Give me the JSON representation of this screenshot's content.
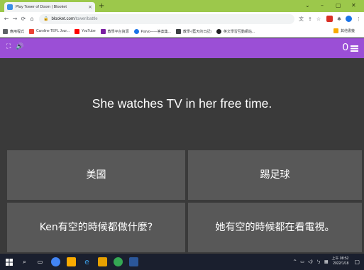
{
  "browser": {
    "tab_title": "Play Tower of Doom | Blooket",
    "tab_close": "×",
    "new_tab": "+",
    "window_controls": {
      "minimize": "⌄",
      "restore": "–",
      "maximize": "▢",
      "close": "✕"
    },
    "nav": {
      "back": "←",
      "forward": "→",
      "reload": "⟳",
      "home": "⌂"
    },
    "url_host": "blooket.com",
    "url_path": "/tower/battle",
    "bookmarks": [
      {
        "label": "應用程式",
        "color": "#5f6368"
      },
      {
        "label": "Caroline TEFL Jour...",
        "color": "#ea4335"
      },
      {
        "label": "YouTube",
        "color": "#ff0000"
      },
      {
        "label": "教學平台資源",
        "color": "#7b1fa2"
      },
      {
        "label": "Parvo——答案集...",
        "color": "#1a73e8"
      },
      {
        "label": "教學-(藍天的日記)",
        "color": "#3c4043"
      },
      {
        "label": "英文學習互動網站...",
        "color": "#202124"
      }
    ],
    "bookmarks_more": "其他書籤"
  },
  "game": {
    "header_icons": "⛶ 🔊",
    "score": "0",
    "question": "She watches TV in her free time.",
    "answers": [
      "美國",
      "踢足球",
      "Ken有空的時候都做什麼?",
      "她有空的時候都在看電視。"
    ],
    "accent_color": "#9b4fd6"
  },
  "taskbar": {
    "clock_time": "上午 08:52",
    "clock_date": "2022/1/18"
  }
}
